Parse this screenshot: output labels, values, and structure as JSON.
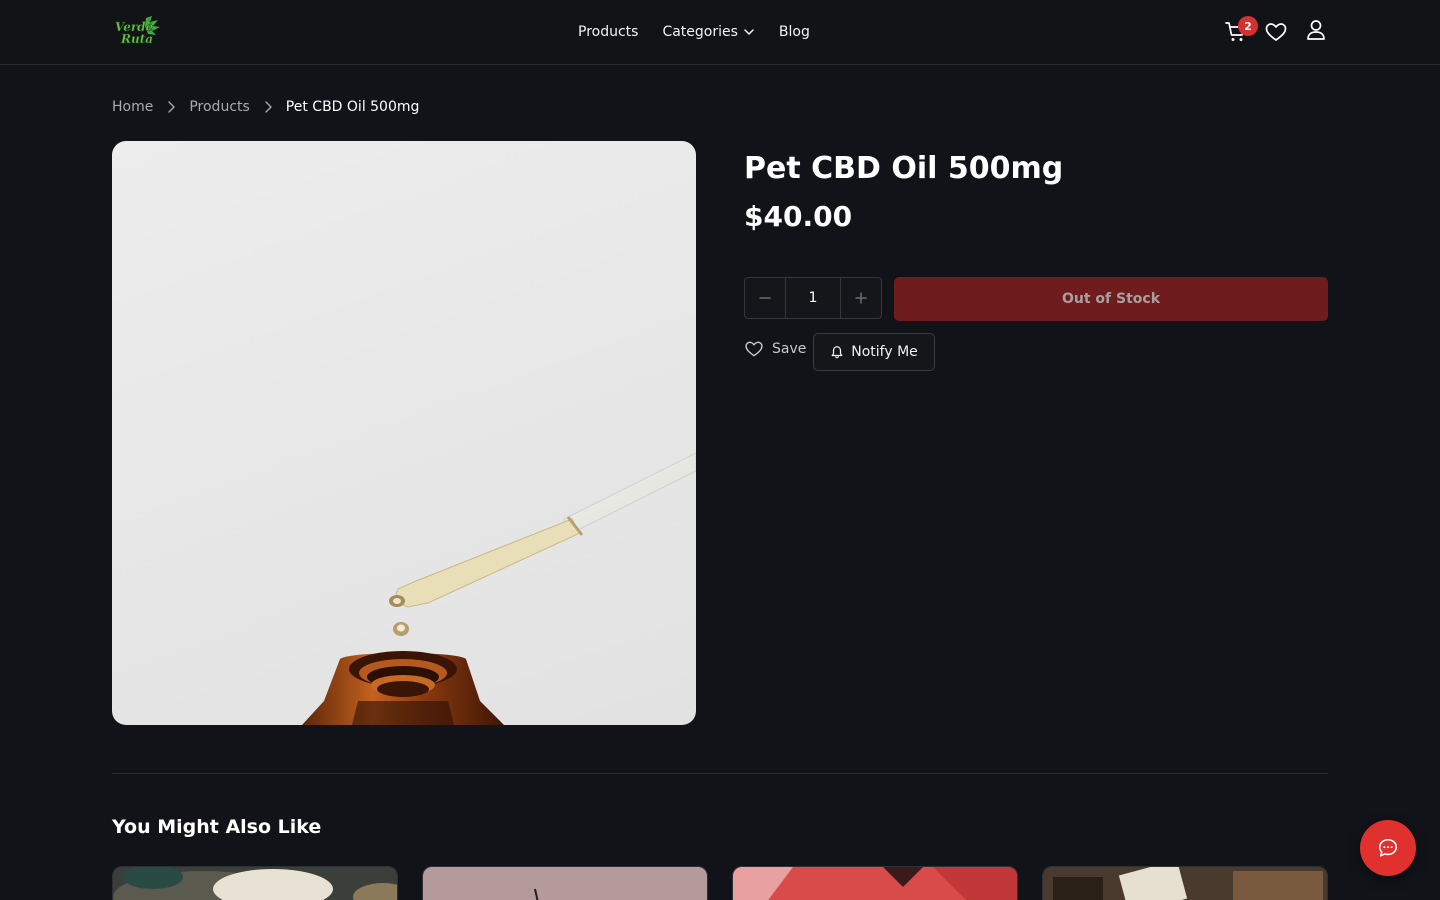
{
  "header": {
    "logo_alt": "Verde Ruta",
    "nav": [
      {
        "label": "Products"
      },
      {
        "label": "Categories"
      },
      {
        "label": "Blog"
      }
    ],
    "cart_count": "2"
  },
  "breadcrumb": {
    "items": [
      "Home",
      "Products",
      "Pet CBD Oil 500mg"
    ]
  },
  "product": {
    "title": "Pet CBD Oil 500mg",
    "price": "$40.00",
    "quantity": "1",
    "status_button": "Out of Stock",
    "save_label": "Save",
    "notify_label": "Notify Me"
  },
  "related": {
    "title": "You Might Also Like"
  },
  "colors": {
    "background": "#111318",
    "accent_red": "#e0312f",
    "out_of_stock": "#6e1c1e",
    "badge": "#d63031"
  },
  "icons": [
    "logo",
    "chevron-down-icon",
    "cart-icon",
    "heart-icon",
    "user-icon",
    "chevron-right-icon",
    "minus-icon",
    "plus-icon",
    "bell-icon",
    "chat-icon"
  ]
}
